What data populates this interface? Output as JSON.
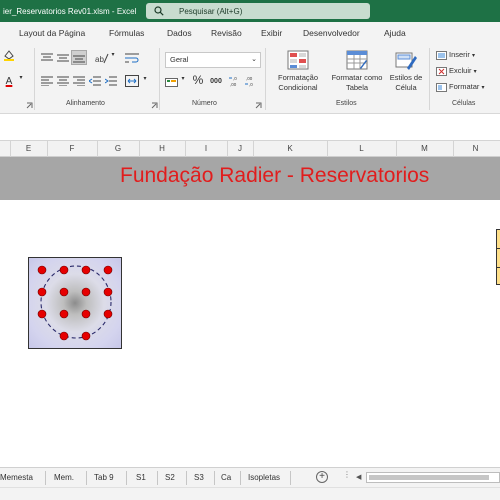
{
  "titlebar": {
    "file_title": "ier_Reservatorios Rev01.xlsm  -  Excel",
    "search_placeholder": "Pesquisar (Alt+G)"
  },
  "ribbon_tabs": [
    "Layout da Página",
    "Fórmulas",
    "Dados",
    "Revisão",
    "Exibir",
    "Desenvolvedor",
    "Ajuda"
  ],
  "ribbon": {
    "alignment_group": "Alinhamento",
    "number_group": "Número",
    "number_format": "Geral",
    "percent_symbol": "%",
    "thousands_symbol": "000",
    "styles_group": "Estilos",
    "conditional_format": "Formatação Condicional",
    "format_as_table": "Formatar como Tabela",
    "cell_styles": "Estilos de Célula",
    "cells_group": "Células",
    "insert": "Inserir",
    "delete": "Excluir",
    "format": "Formatar"
  },
  "columns": [
    "E",
    "F",
    "G",
    "H",
    "I",
    "J",
    "K",
    "L",
    "M",
    "N"
  ],
  "sheet": {
    "banner_title": "Fundação Radier - Reservatorios"
  },
  "sheet_tabs": [
    "Memesta",
    "Mem.",
    "Tab 9",
    "S1",
    "S2",
    "S3",
    "Ca",
    "Isopletas"
  ],
  "colors": {
    "excel_green": "#1e7145",
    "banner_gray": "#a6a6a6",
    "banner_text_red": "#e11d1d",
    "dot_red": "#e60000"
  }
}
